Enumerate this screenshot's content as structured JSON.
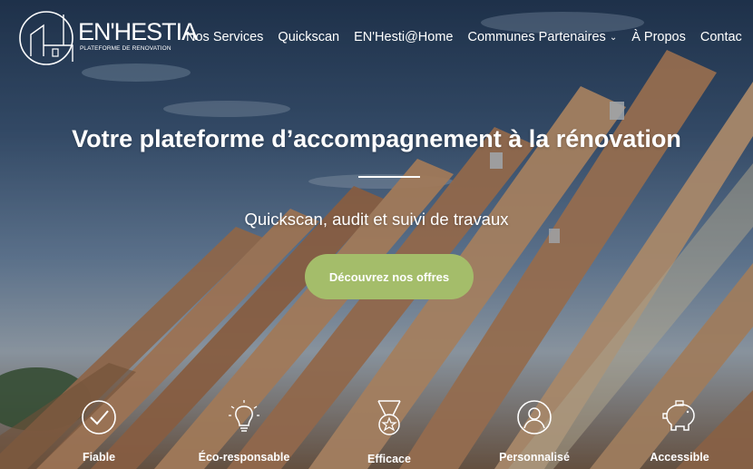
{
  "brand": {
    "name": "EN'HESTIA",
    "tagline": "PLATEFORME DE RENOVATION"
  },
  "nav": {
    "items": [
      {
        "label": "Nos Services"
      },
      {
        "label": "Quickscan"
      },
      {
        "label": "EN'Hesti@Home"
      },
      {
        "label": "Communes Partenaires",
        "has_dropdown": true
      },
      {
        "label": "À Propos"
      },
      {
        "label": "Contac"
      }
    ]
  },
  "hero": {
    "title": "Votre plateforme d’accompagnement à la rénovation",
    "subtitle": "Quickscan, audit et suivi de travaux",
    "cta_label": "Découvrez nos offres"
  },
  "features": [
    {
      "label": "Fiable",
      "icon": "check-circle-icon"
    },
    {
      "label": "Éco-responsable",
      "icon": "lightbulb-icon"
    },
    {
      "label": "Efficace",
      "icon": "medal-icon"
    },
    {
      "label": "Personnalisé",
      "icon": "person-icon"
    },
    {
      "label": "Accessible",
      "icon": "piggy-bank-icon"
    }
  ],
  "colors": {
    "accent": "#a4bd6a",
    "text": "#ffffff"
  }
}
